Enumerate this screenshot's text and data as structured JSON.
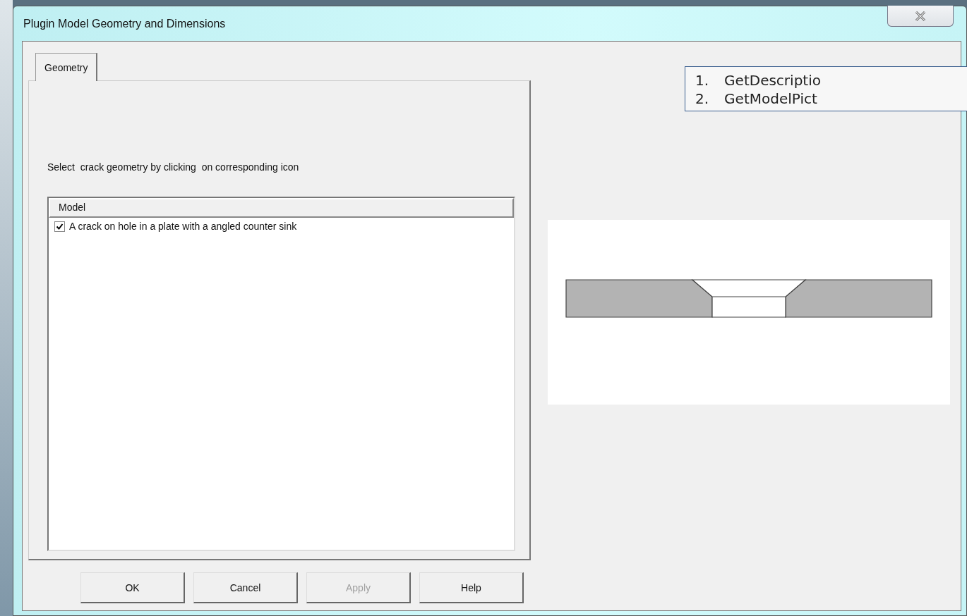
{
  "window": {
    "title": "Plugin Model Geometry and Dimensions"
  },
  "tabs": [
    {
      "label": "Geometry",
      "selected": true
    }
  ],
  "instruction": "Select  crack geometry by clicking  on corresponding icon",
  "model_list": {
    "header": "Model",
    "items": [
      {
        "label": "A crack on hole in a plate with a angled counter sink",
        "checked": true
      }
    ]
  },
  "buttons": [
    {
      "label": "OK",
      "disabled": false
    },
    {
      "label": "Cancel",
      "disabled": false
    },
    {
      "label": "Apply",
      "disabled": true
    },
    {
      "label": "Help",
      "disabled": false
    }
  ],
  "annotation": [
    {
      "number": "1.",
      "text": "GetDescriptio"
    },
    {
      "number": "2.",
      "text": "GetModelPict"
    }
  ]
}
